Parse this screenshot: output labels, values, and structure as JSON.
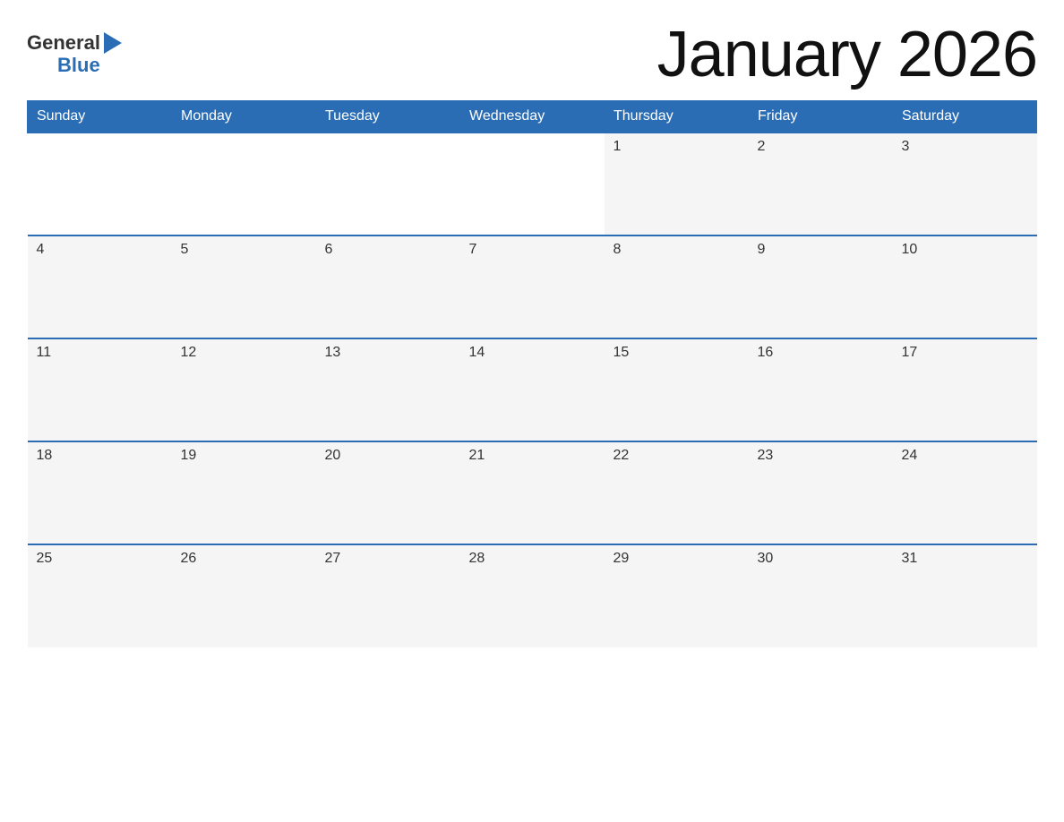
{
  "logo": {
    "general_text": "General",
    "blue_text": "Blue"
  },
  "header": {
    "month_title": "January 2026"
  },
  "weekdays": [
    "Sunday",
    "Monday",
    "Tuesday",
    "Wednesday",
    "Thursday",
    "Friday",
    "Saturday"
  ],
  "weeks": [
    [
      {
        "day": "",
        "empty": true
      },
      {
        "day": "",
        "empty": true
      },
      {
        "day": "",
        "empty": true
      },
      {
        "day": "",
        "empty": true
      },
      {
        "day": "1",
        "empty": false
      },
      {
        "day": "2",
        "empty": false
      },
      {
        "day": "3",
        "empty": false
      }
    ],
    [
      {
        "day": "4",
        "empty": false
      },
      {
        "day": "5",
        "empty": false
      },
      {
        "day": "6",
        "empty": false
      },
      {
        "day": "7",
        "empty": false
      },
      {
        "day": "8",
        "empty": false
      },
      {
        "day": "9",
        "empty": false
      },
      {
        "day": "10",
        "empty": false
      }
    ],
    [
      {
        "day": "11",
        "empty": false
      },
      {
        "day": "12",
        "empty": false
      },
      {
        "day": "13",
        "empty": false
      },
      {
        "day": "14",
        "empty": false
      },
      {
        "day": "15",
        "empty": false
      },
      {
        "day": "16",
        "empty": false
      },
      {
        "day": "17",
        "empty": false
      }
    ],
    [
      {
        "day": "18",
        "empty": false
      },
      {
        "day": "19",
        "empty": false
      },
      {
        "day": "20",
        "empty": false
      },
      {
        "day": "21",
        "empty": false
      },
      {
        "day": "22",
        "empty": false
      },
      {
        "day": "23",
        "empty": false
      },
      {
        "day": "24",
        "empty": false
      }
    ],
    [
      {
        "day": "25",
        "empty": false
      },
      {
        "day": "26",
        "empty": false
      },
      {
        "day": "27",
        "empty": false
      },
      {
        "day": "28",
        "empty": false
      },
      {
        "day": "29",
        "empty": false
      },
      {
        "day": "30",
        "empty": false
      },
      {
        "day": "31",
        "empty": false
      }
    ]
  ]
}
